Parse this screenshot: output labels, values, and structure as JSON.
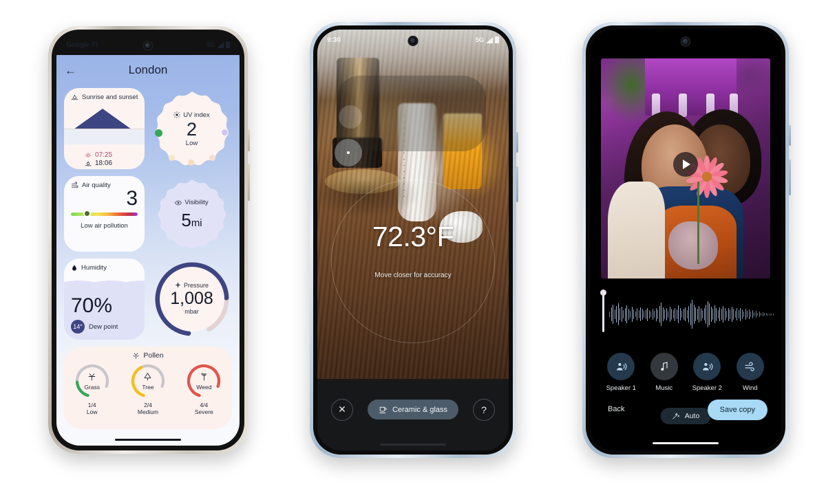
{
  "phone1": {
    "status": {
      "carrier": "Google Fi",
      "network": "5G"
    },
    "nav": {
      "back_icon": "arrow-left-icon",
      "title": "London"
    },
    "sunrise": {
      "title": "Sunrise and sunset",
      "icon": "sunset-icon",
      "sunrise_icon": "sunrise-sun-icon",
      "sunrise_time": "07:25",
      "sunset_icon": "sunset-icon",
      "sunset_time": "18:06"
    },
    "uv": {
      "title": "UV index",
      "icon": "sun-rays-icon",
      "value": "2",
      "level": "Low"
    },
    "air_quality": {
      "title": "Air quality",
      "icon": "air-waves-icon",
      "value": "3",
      "description": "Low air pollution"
    },
    "visibility": {
      "title": "Visibility",
      "icon": "eye-icon",
      "value": "5",
      "unit": "mi"
    },
    "humidity": {
      "title": "Humidity",
      "icon": "water-drop-icon",
      "value": "70%",
      "dew_point_value": "14°",
      "dew_point_label": "Dew point"
    },
    "pressure": {
      "title": "Pressure",
      "icon": "pressure-icon",
      "value": "1,008",
      "unit": "mbar"
    },
    "pollen": {
      "title": "Pollen",
      "icon": "pollen-icon",
      "items": [
        {
          "name": "Grass",
          "icon": "grass-icon",
          "ratio": "1/4",
          "level": "Low",
          "color": "#34a853",
          "pct": 25
        },
        {
          "name": "Tree",
          "icon": "tree-icon",
          "ratio": "2/4",
          "level": "Medium",
          "color": "#f2c017",
          "pct": 50
        },
        {
          "name": "Weed",
          "icon": "weed-icon",
          "ratio": "4/4",
          "level": "Severe",
          "color": "#e2554c",
          "pct": 100
        }
      ]
    }
  },
  "phone2": {
    "status": {
      "time": "9:30",
      "network": "5G"
    },
    "reading": {
      "temperature": "72.3°F",
      "hint": "Move closer for accuracy"
    },
    "toolbar": {
      "close_icon": "close-icon",
      "material_icon": "ceramic-mug-icon",
      "material_label": "Ceramic & glass",
      "help_icon": "help-circle-icon"
    }
  },
  "phone3": {
    "player": {
      "play_icon": "play-triangle-icon"
    },
    "tools": [
      {
        "label": "Speaker 1",
        "icon": "person-speaking-icon",
        "active": true
      },
      {
        "label": "Music",
        "icon": "music-note-icon",
        "active": false
      },
      {
        "label": "Speaker 2",
        "icon": "person-speaking-icon",
        "active": true
      },
      {
        "label": "Wind",
        "icon": "wind-icon",
        "active": true
      }
    ],
    "auto": {
      "label": "Auto",
      "icon": "magic-wand-icon"
    },
    "footer": {
      "back_label": "Back",
      "save_label": "Save copy"
    }
  },
  "colors": {
    "accent_blue": "#a8d9f5",
    "navy": "#3d4582",
    "uv_green": "#34a853",
    "pollen_grass": "#34a853",
    "pollen_tree": "#f2c017",
    "pollen_weed": "#e2554c",
    "material_pill": "#4b5b69"
  }
}
